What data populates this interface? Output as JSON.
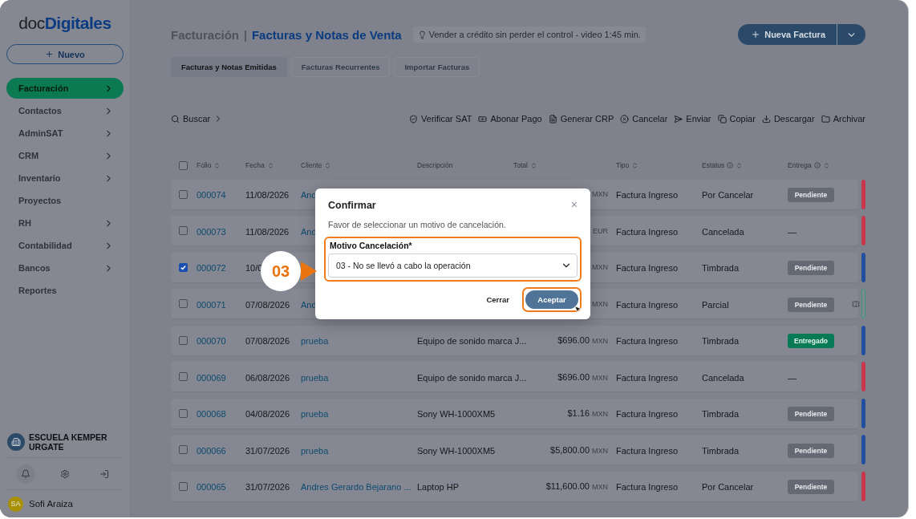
{
  "sidebar": {
    "logo": "doc**Digitales**",
    "new_button": "Nuevo",
    "items": [
      {
        "label": "Facturación",
        "selected": true,
        "expandable": true
      },
      {
        "label": "Contactos",
        "selected": false,
        "expandable": true
      },
      {
        "label": "AdminSAT",
        "selected": false,
        "expandable": true
      },
      {
        "label": "CRM",
        "selected": false,
        "expandable": true
      },
      {
        "label": "Inventario",
        "selected": false,
        "expandable": true
      },
      {
        "label": "Proyectos",
        "selected": false,
        "expandable": false
      },
      {
        "label": "RH",
        "selected": false,
        "expandable": true
      },
      {
        "label": "Contabilidad",
        "selected": false,
        "expandable": true
      },
      {
        "label": "Bancos",
        "selected": false,
        "expandable": true
      },
      {
        "label": "Reportes",
        "selected": false,
        "expandable": false
      }
    ],
    "company": "ESCUELA KEMPER URGATE",
    "user": {
      "initials": "SA",
      "name": "Sofi Araiza"
    }
  },
  "header": {
    "section": "Facturación",
    "separator": "|",
    "title": "Facturas y Notas de Venta",
    "tip": "Vender a crédito sin perder el control - video 1:45 min.",
    "new_button": "Nueva Factura"
  },
  "tabs": [
    {
      "label": "Facturas y Notas Emitidas",
      "selected": true
    },
    {
      "label": "Facturas Recurrentes",
      "selected": false
    },
    {
      "label": "Importar Facturas",
      "selected": false
    }
  ],
  "toolbar": {
    "search": "Buscar",
    "actions": [
      {
        "kind": "verify",
        "label": "Verificar SAT"
      },
      {
        "kind": "payment",
        "label": "Abonar Pago"
      },
      {
        "kind": "document",
        "label": "Generar CRP"
      },
      {
        "kind": "cancel",
        "label": "Cancelar"
      },
      {
        "kind": "send",
        "label": "Enviar"
      },
      {
        "kind": "copy",
        "label": "Copiar"
      },
      {
        "kind": "download",
        "label": "Descargar"
      },
      {
        "kind": "archive",
        "label": "Archivar"
      }
    ]
  },
  "table": {
    "select_all": {
      "checked": false
    },
    "columns": [
      {
        "label": "Folio",
        "sortable": true,
        "info": false
      },
      {
        "label": "Fecha",
        "sortable": true,
        "info": false
      },
      {
        "label": "Cliente",
        "sortable": true,
        "info": false
      },
      {
        "label": "Descripción",
        "sortable": false,
        "info": false
      },
      {
        "label": "Total",
        "sortable": true,
        "info": false
      },
      {
        "label": "Tipo",
        "sortable": true,
        "info": false
      },
      {
        "label": "Estatus",
        "sortable": true,
        "info": true
      },
      {
        "label": "Entrega",
        "sortable": true,
        "info": true
      }
    ],
    "rows": [
      {
        "selected": false,
        "folio": "000074",
        "fecha": "11/08/2026",
        "cliente": "And",
        "currency": "MXN",
        "tipo": "Factura Ingreso",
        "estatus": "Por Cancelar",
        "entrega": {
          "kind": "pending",
          "label": "Pendiente"
        },
        "color": "#c9354a",
        "outlined": false,
        "attachment": false
      },
      {
        "selected": false,
        "folio": "000073",
        "fecha": "11/08/2026",
        "cliente": "And",
        "currency": "EUR",
        "tipo": "Factura Ingreso",
        "estatus": "Cancelada",
        "entrega": {
          "kind": "none",
          "label": "—"
        },
        "color": "#c9354a",
        "outlined": false,
        "attachment": false
      },
      {
        "selected": true,
        "folio": "000072",
        "fecha": "10/0",
        "currency": "MXN",
        "tipo": "Factura Ingreso",
        "estatus": "Timbrada",
        "entrega": {
          "kind": "pending",
          "label": "Pendiente"
        },
        "color": "#1f4f9e",
        "outlined": false,
        "attachment": false
      },
      {
        "selected": false,
        "folio": "000071",
        "fecha": "07/08/2026",
        "cliente": "And",
        "currency": "MXN",
        "tipo": "Factura Ingreso",
        "estatus": "Parcial",
        "entrega": {
          "kind": "pending",
          "label": "Pendiente"
        },
        "color": "#2f9e78",
        "outlined": true,
        "attachment": true
      },
      {
        "selected": false,
        "folio": "000070",
        "fecha": "07/08/2026",
        "cliente": "prueba",
        "descripcion": "Equipo de sonido marca J...",
        "amount": "$696.00",
        "currency": "MXN",
        "tipo": "Factura Ingreso",
        "estatus": "Timbrada",
        "entrega": {
          "kind": "delivered",
          "label": "Entregado"
        },
        "color": "#1f4f9e",
        "outlined": false,
        "attachment": false
      },
      {
        "selected": false,
        "folio": "000069",
        "fecha": "06/08/2026",
        "cliente": "prueba",
        "descripcion": "Equipo de sonido marca J...",
        "amount": "$696.00",
        "currency": "MXN",
        "tipo": "Factura Ingreso",
        "estatus": "Cancelada",
        "entrega": {
          "kind": "none",
          "label": "—"
        },
        "color": "#c9354a",
        "outlined": false,
        "attachment": false
      },
      {
        "selected": false,
        "folio": "000068",
        "fecha": "04/08/2026",
        "cliente": "prueba",
        "descripcion": "Sony WH-1000XM5",
        "amount": "$1.16",
        "currency": "MXN",
        "tipo": "Factura Ingreso",
        "estatus": "Timbrada",
        "entrega": {
          "kind": "pending",
          "label": "Pendiente"
        },
        "color": "#1f4f9e",
        "outlined": false,
        "attachment": false
      },
      {
        "selected": false,
        "folio": "000066",
        "fecha": "31/07/2026",
        "cliente": "prueba",
        "descripcion": "Sony WH-1000XM5",
        "amount": "$5,800.00",
        "currency": "MXN",
        "tipo": "Factura Ingreso",
        "estatus": "Timbrada",
        "entrega": {
          "kind": "pending",
          "label": "Pendiente"
        },
        "color": "#1f4f9e",
        "outlined": false,
        "attachment": false
      },
      {
        "selected": false,
        "folio": "000065",
        "fecha": "31/07/2026",
        "cliente": "Andres Gerardo Bejarano ...",
        "descripcion": "Laptop HP",
        "amount": "$11,600.00",
        "currency": "MXN",
        "tipo": "Factura Ingreso",
        "estatus": "Por Cancelar",
        "entrega": {
          "kind": "pending",
          "label": "Pendiente"
        },
        "color": "#c9354a",
        "outlined": false,
        "attachment": false
      }
    ]
  },
  "dialog": {
    "title": "Confirmar",
    "close": "×",
    "message": "Favor de seleccionar un motivo de cancelación.",
    "field_label": "Motivo Cancelación*",
    "field_value": "03 - No se llevó a cabo la operación",
    "cancel": "Cerrar",
    "confirm": "Aceptar"
  },
  "callout": {
    "step": "03"
  }
}
